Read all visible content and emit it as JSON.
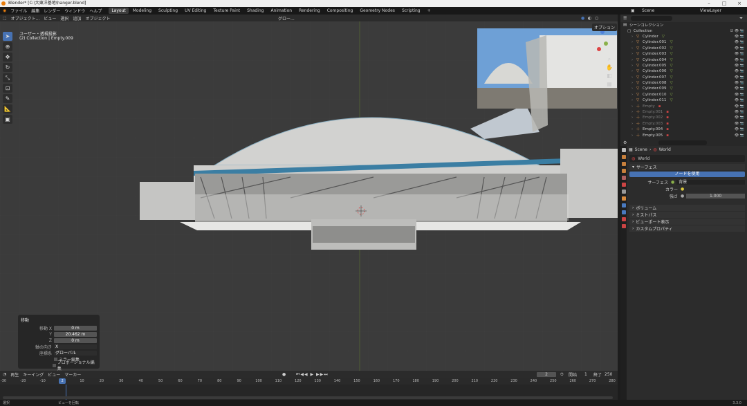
{
  "window": {
    "title": "Blender* [C:\\大東洋基地\\hanger.blend]"
  },
  "menus": [
    "ファイル",
    "編集",
    "レンダー",
    "ウィンドウ",
    "ヘルプ"
  ],
  "workspaces": [
    "Layout",
    "Modeling",
    "Sculpting",
    "UV Editing",
    "Texture Paint",
    "Shading",
    "Animation",
    "Rendering",
    "Compositing",
    "Geometry Nodes",
    "Scripting",
    "+"
  ],
  "viewport_header": {
    "mode": "オブジェクト...",
    "view": "ビュー",
    "select": "選択",
    "add": "追加",
    "object": "オブジェクト",
    "transform": "グロー..."
  },
  "viewport": {
    "line1": "ユーザー・透視投影",
    "line2": "(2) Collection | Empty.009",
    "options": "オプション"
  },
  "op_panel": {
    "title": "移動",
    "rows": [
      {
        "label": "移動 X",
        "value": "0 m"
      },
      {
        "label": "Y",
        "value": "20.462 m"
      },
      {
        "label": "Z",
        "value": "0 m"
      }
    ],
    "axis_label": "軸の向き",
    "axis_value": "X",
    "orient_label": "座標系",
    "orient_value": "グローバル",
    "mirror": "ミラー編集",
    "proportional": "プロポーショナル編集"
  },
  "timeline": {
    "menu": [
      "再生",
      "キーイング",
      "ビュー",
      "マーカー"
    ],
    "current_frame": "2",
    "start_label": "開始",
    "start": "1",
    "end_label": "終了",
    "end": "250",
    "ticks": [
      "-30",
      "-20",
      "-10",
      "2",
      "10",
      "20",
      "30",
      "40",
      "50",
      "60",
      "70",
      "80",
      "90",
      "100",
      "110",
      "120",
      "130",
      "140",
      "150",
      "160",
      "170",
      "180",
      "190",
      "200",
      "210",
      "220",
      "230",
      "240",
      "250",
      "260",
      "270",
      "280"
    ]
  },
  "statusbar": {
    "left": "選択",
    "middle": "ビューを回転",
    "version": "3.3.0"
  },
  "outliner": {
    "scene": "Scene",
    "viewlayer": "ViewLayer",
    "header": "シーンコレクション",
    "collection": "Collection",
    "items": [
      {
        "name": "Cylinder",
        "dim": false
      },
      {
        "name": "Cylinder.001",
        "dim": false
      },
      {
        "name": "Cylinder.002",
        "dim": false
      },
      {
        "name": "Cylinder.003",
        "dim": false
      },
      {
        "name": "Cylinder.004",
        "dim": false
      },
      {
        "name": "Cylinder.005",
        "dim": false
      },
      {
        "name": "Cylinder.006",
        "dim": false
      },
      {
        "name": "Cylinder.007",
        "dim": false
      },
      {
        "name": "Cylinder.008",
        "dim": false
      },
      {
        "name": "Cylinder.009",
        "dim": false
      },
      {
        "name": "Cylinder.010",
        "dim": false
      },
      {
        "name": "Cylinder.011",
        "dim": false
      },
      {
        "name": "Empty",
        "dim": true
      },
      {
        "name": "Empty.001",
        "dim": true
      },
      {
        "name": "Empty.002",
        "dim": true
      },
      {
        "name": "Empty.003",
        "dim": true
      },
      {
        "name": "Empty.004",
        "dim": false
      },
      {
        "name": "Empty.005",
        "dim": false
      }
    ]
  },
  "properties": {
    "breadcrumb_scene": "Scene",
    "breadcrumb_world": "World",
    "world_name": "World",
    "surface_panel": "サーフェス",
    "use_nodes": "ノードを使用",
    "surface_label": "サーフェス",
    "surface_value": "背景",
    "color_label": "カラー",
    "strength_label": "強さ",
    "strength_value": "1.000",
    "panels": [
      "ボリューム",
      "ミストパス",
      "ビューポート表示",
      "カスタムプロパティ"
    ]
  },
  "colors": {
    "accent": "#4772b3",
    "header": "#2b2b2b",
    "viewport": "#3b3b3b"
  }
}
